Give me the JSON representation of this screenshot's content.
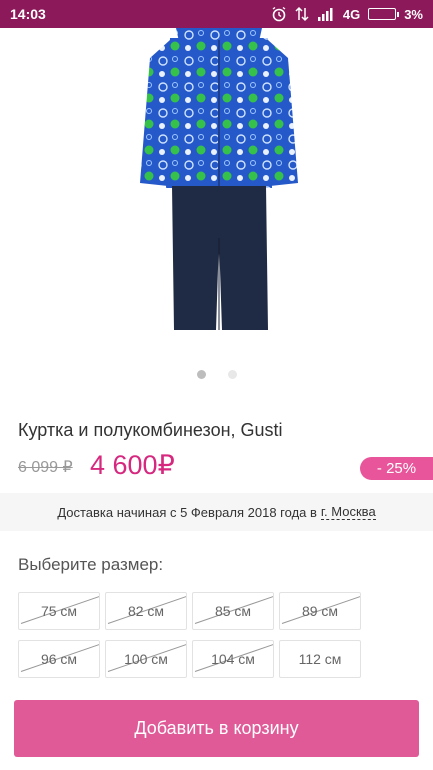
{
  "status_bar": {
    "time": "14:03",
    "network": "4G",
    "battery": "3%",
    "icons": [
      "alarm-icon",
      "data-transfer-icon",
      "signal-icon",
      "battery-icon"
    ]
  },
  "gallery": {
    "image_name": "winter-jacket-and-overalls-photo",
    "dots": 2,
    "active_dot": 0
  },
  "product": {
    "title": "Куртка и полукомбинезон, Gusti",
    "old_price": "6 099 ₽",
    "new_price": "4 600₽",
    "discount": "- 25%"
  },
  "delivery": {
    "text": "Доставка начиная с 5 Февраля 2018 года в",
    "city": "г. Москва"
  },
  "sizes": {
    "label": "Выберите размер:",
    "items": [
      {
        "label": "75 см",
        "available": false
      },
      {
        "label": "82 см",
        "available": false
      },
      {
        "label": "85 см",
        "available": false
      },
      {
        "label": "89 см",
        "available": false
      },
      {
        "label": "96 см",
        "available": false
      },
      {
        "label": "100 см",
        "available": false
      },
      {
        "label": "104 см",
        "available": false
      },
      {
        "label": "112 см",
        "available": true
      }
    ]
  },
  "cart": {
    "button_label": "Добавить в корзину"
  },
  "colors": {
    "status_bar": "#8c1a5a",
    "accent": "#d6287f",
    "button": "#e05a98"
  }
}
